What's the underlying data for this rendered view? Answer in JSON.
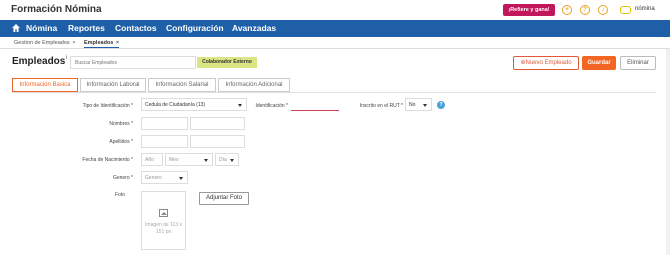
{
  "header": {
    "app_title": "Formación Nómina",
    "refer_button": "¡Refiere y gana!",
    "icons": [
      "plus-icon",
      "help-icon",
      "bell-icon"
    ],
    "user_label": "nómina"
  },
  "nav": {
    "items": [
      "Nómina",
      "Reportes",
      "Contactos",
      "Configuración",
      "Avanzadas"
    ]
  },
  "doc_tabs": [
    {
      "label": "Gestion de Empleados",
      "close": "×"
    },
    {
      "label": "Empleados",
      "close": "×"
    }
  ],
  "page": {
    "title": "Empleados",
    "info_mark": "i",
    "search_placeholder": "Buscar Empleados",
    "external_button": "Colaborador Externo",
    "new_button": "⊕Nuevo Empleado",
    "save_button": "Guardar",
    "delete_button": "Eliminar"
  },
  "section_tabs": [
    "Información Basica",
    "Información Laboral",
    "Información Salarial",
    "Información Adicional"
  ],
  "form": {
    "id_type_label": "Tipo de Identificación *",
    "id_type_value": "Cedula de Ciudadanía (13)",
    "id_label": "Identificación *",
    "id_value": "",
    "rut_label": "Inscrito en el RUT *",
    "rut_value": "No",
    "help_mark": "?",
    "names_label": "Nombres *",
    "surnames_label": "Apellidos *",
    "birth_label": "Fecha de Nacimiento *",
    "birth_year_placeholder": "Año",
    "birth_month_placeholder": "Mes",
    "birth_day_placeholder": "Día",
    "gender_label": "Genero *",
    "gender_placeholder": "Genero",
    "photo_label": "Foto",
    "photo_placeholder": "Imagen de 113 x 151 px",
    "attach_button": "Adjuntar Foto"
  },
  "colors": {
    "nav_bg": "#1e5fa8",
    "accent_orange": "#f26522",
    "refer_bg": "#c2185b",
    "external_bg": "#d9e683",
    "help_blue": "#4aa3d8"
  }
}
